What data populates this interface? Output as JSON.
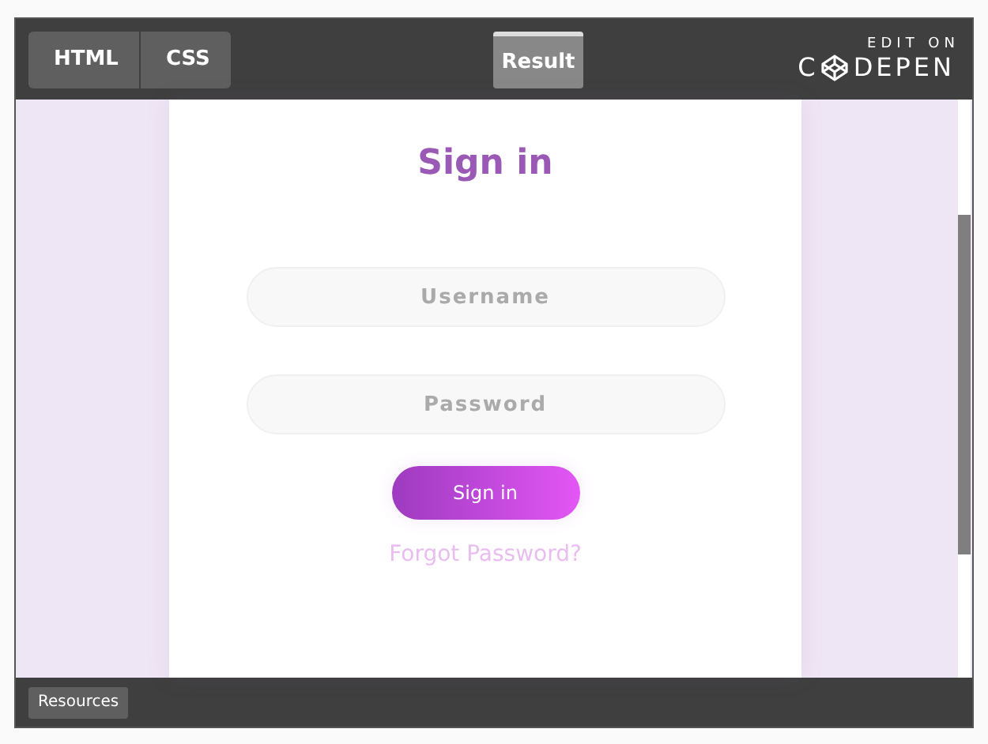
{
  "editor_tabs": [
    {
      "label": "HTML",
      "selected": false
    },
    {
      "label": "CSS",
      "selected": false
    }
  ],
  "result_tab": {
    "label": "Result",
    "selected": true
  },
  "brand": {
    "caption": "EDIT ON",
    "name_start": "C",
    "name_end": "DEPEN"
  },
  "form": {
    "title": "Sign in",
    "fields": [
      {
        "placeholder": "Username"
      },
      {
        "placeholder": "Password"
      }
    ],
    "submit": "Sign in",
    "forgot_link": "Forgot Password?"
  },
  "footer": {
    "button": "Resources"
  }
}
